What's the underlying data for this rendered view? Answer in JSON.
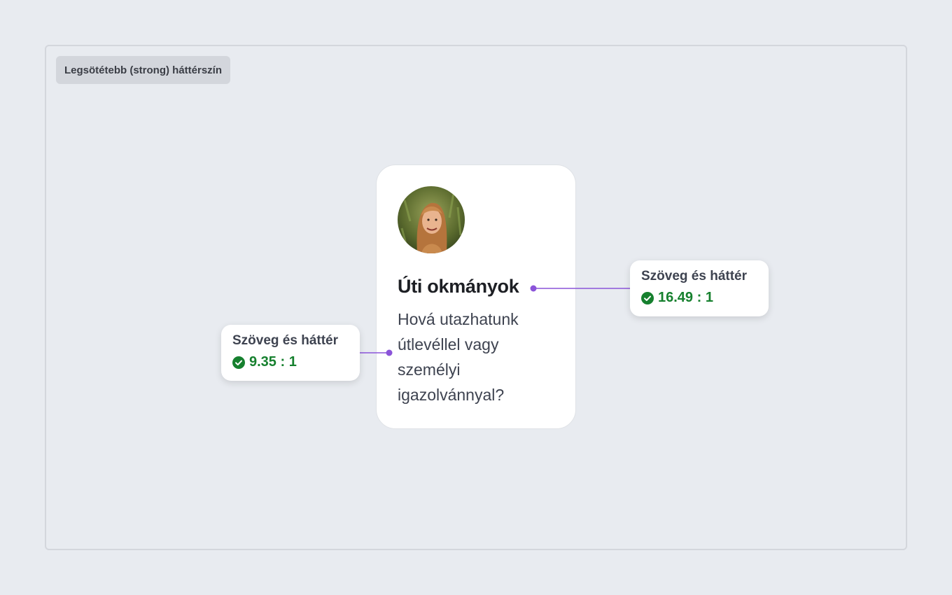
{
  "frame": {
    "label": "Legsötétebb (strong) háttérszín"
  },
  "card": {
    "avatar_alt": "avatar",
    "title": "Úti okmányok",
    "body": "Hová utazhatunk útlevéllel vagy személyi igazolvánnyal?"
  },
  "callouts": {
    "left": {
      "title": "Szöveg és háttér",
      "ratio": "9.35 : 1",
      "icon": "check-circle-icon"
    },
    "right": {
      "title": "Szöveg és háttér",
      "ratio": "16.49 : 1",
      "icon": "check-circle-icon"
    }
  },
  "colors": {
    "page_background": "#e8ebf0",
    "connector": "#8b54d9",
    "pass": "#16802e"
  }
}
